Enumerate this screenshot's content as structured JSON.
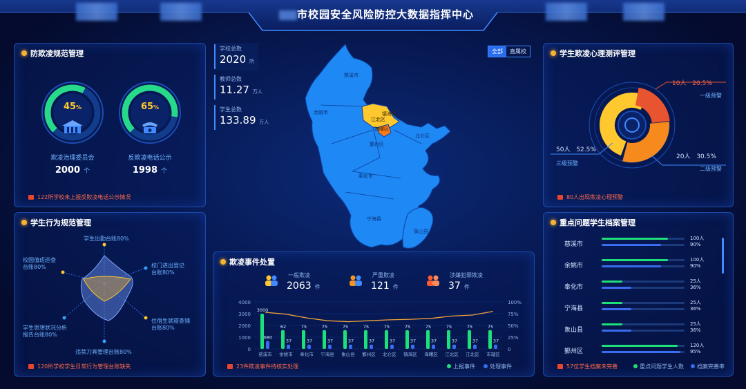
{
  "header": {
    "title_suffix": "市校园安全风险防控大数据指挥中心"
  },
  "stats": [
    {
      "label": "学校总数",
      "value": "2020",
      "unit": "所"
    },
    {
      "label": "教师总数",
      "value": "11.27",
      "unit": "万人"
    },
    {
      "label": "学生总数",
      "value": "133.89",
      "unit": "万人"
    }
  ],
  "map": {
    "toggle": [
      "全部",
      "直属校"
    ],
    "regions": [
      "慈溪市",
      "余姚市",
      "江北区",
      "镇海区",
      "海曙区",
      "鄞州区",
      "北仑区",
      "奉化市",
      "宁海县",
      "象山县"
    ],
    "highlight_colors": {
      "base": "#1e88f5",
      "yellow": "#ffc82e",
      "orange": "#ff7a1a"
    }
  },
  "anti_bully": {
    "title": "防欺凌规范管理",
    "gauges": [
      {
        "percent": "45",
        "percent_value": 45,
        "label": "欺凌治理委员会",
        "count": "2000",
        "unit": "个",
        "icon": "building-icon"
      },
      {
        "percent": "65",
        "percent_value": 65,
        "label": "反欺凌电话公示",
        "count": "1998",
        "unit": "个",
        "icon": "phone-icon"
      }
    ],
    "footer": "122所学校未上报反欺凌电话公示情况"
  },
  "behavior": {
    "title": "学生行为规范管理",
    "axes": [
      "学生出勤台账80%",
      "校门进出登记\n台账80%",
      "住宿生就寝查铺\n台账80%",
      "违禁刀具管理台账80%",
      "学生思想状况分析\n报告台账80%",
      "校园值班巡查\n台账80%"
    ],
    "footer": "120所学校学生日常行为管理台账缺失"
  },
  "psych": {
    "title": "学生欺凌心理测评管理",
    "segments": [
      {
        "count": "10人",
        "pct": "20.5%",
        "level": "一级预警",
        "value": 20.5,
        "color": "#e8542f"
      },
      {
        "count": "20人",
        "pct": "30.5%",
        "level": "二级预警",
        "value": 30.5,
        "color": "#f78a1d"
      },
      {
        "count": "50人",
        "pct": "52.5%",
        "level": "三级预警",
        "value": 52.5,
        "color": "#ffc82e"
      }
    ],
    "footer": "80人出现欺凌心理预警"
  },
  "events": {
    "title": "欺凌事件处置",
    "kpis": [
      {
        "label": "一般欺凌",
        "value": "2063",
        "unit": "件",
        "color": "#ffc82e"
      },
      {
        "label": "严重欺凌",
        "value": "121",
        "unit": "件",
        "color": "#f7941d"
      },
      {
        "label": "涉嫌犯罪欺凌",
        "value": "37",
        "unit": "件",
        "color": "#ff5a2e"
      }
    ],
    "footer": "23件欺凌事件待核实处理",
    "legend": [
      "上报事件",
      "处理事件"
    ]
  },
  "chart_data": {
    "type": "bar",
    "categories": [
      "慈溪市",
      "余姚市",
      "奉化市",
      "宁海县",
      "象山县",
      "鄞州区",
      "北仑区",
      "镇海区",
      "海曙区",
      "江北区",
      "江北区",
      "市辖区"
    ],
    "series": [
      {
        "name": "上报事件",
        "values": [
          3000,
          1600,
          1600,
          1600,
          1600,
          1600,
          1600,
          1600,
          1600,
          1600,
          1600,
          1600
        ],
        "labels": [
          "3000",
          "62",
          "75",
          "75",
          "75",
          "75",
          "75",
          "75",
          "75",
          "75",
          "75",
          "75"
        ],
        "color": "#1ee07a"
      },
      {
        "name": "处理事件",
        "values": [
          680,
          370,
          370,
          370,
          370,
          370,
          370,
          370,
          370,
          370,
          370,
          370
        ],
        "labels": [
          "680",
          "37",
          "37",
          "37",
          "37",
          "37",
          "37",
          "37",
          "37",
          "37",
          "37",
          "37"
        ],
        "color": "#3a6cf0"
      }
    ],
    "line": {
      "values": [
        78,
        74,
        66,
        60,
        58,
        60,
        62,
        63,
        65,
        70,
        72,
        80
      ],
      "color": "#f0a33a"
    },
    "y_left": {
      "ticks": [
        "4000",
        "3000",
        "2000",
        "1000",
        "0"
      ],
      "max": 4000
    },
    "y_right": {
      "ticks": [
        "100%",
        "75%",
        "50%",
        "25%",
        "0"
      ],
      "max": 100
    }
  },
  "key_students": {
    "title": "重点问题学生档案管理",
    "rows": [
      {
        "name": "慈溪市",
        "count": "100人",
        "pct": "90%",
        "count_fill": 0.8,
        "pct_fill": 0.72
      },
      {
        "name": "余姚市",
        "count": "100人",
        "pct": "90%",
        "count_fill": 0.8,
        "pct_fill": 0.72
      },
      {
        "name": "奉化市",
        "count": "25人",
        "pct": "36%",
        "count_fill": 0.25,
        "pct_fill": 0.36
      },
      {
        "name": "宁海县",
        "count": "25人",
        "pct": "36%",
        "count_fill": 0.25,
        "pct_fill": 0.36
      },
      {
        "name": "象山县",
        "count": "25人",
        "pct": "36%",
        "count_fill": 0.25,
        "pct_fill": 0.36
      },
      {
        "name": "鄞州区",
        "count": "120人",
        "pct": "95%",
        "count_fill": 0.92,
        "pct_fill": 0.95
      }
    ],
    "footer": "57位学生档案未完善",
    "legend": [
      "重点问题学生人数",
      "档案完善率"
    ]
  }
}
